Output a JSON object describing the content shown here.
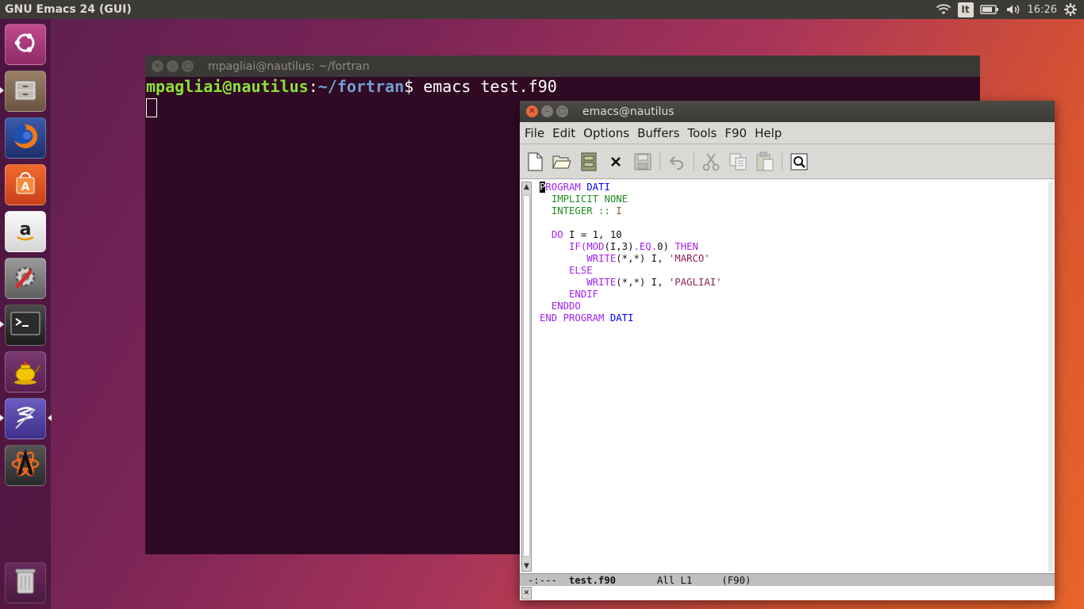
{
  "top_panel": {
    "app_title": "GNU Emacs 24 (GUI)",
    "keyboard_layout": "It",
    "clock": "16:26"
  },
  "launcher": {
    "items": [
      {
        "name": "ubuntu-dash",
        "icon": "ubuntu-logo-icon",
        "color": "#b0397f"
      },
      {
        "name": "files",
        "icon": "file-cabinet-icon",
        "color": "#8a6f52"
      },
      {
        "name": "firefox",
        "icon": "firefox-icon",
        "color": "#e66000"
      },
      {
        "name": "software-center",
        "icon": "shopping-bag-icon",
        "color": "#e95420"
      },
      {
        "name": "amazon",
        "icon": "amazon-icon",
        "color": "#f3f3f3"
      },
      {
        "name": "system-settings",
        "icon": "settings-wrench-icon",
        "color": "#888"
      },
      {
        "name": "terminal",
        "icon": "terminal-icon",
        "color": "#2c2c2c"
      },
      {
        "name": "teapot",
        "icon": "teapot-icon",
        "color": "#f5c400"
      },
      {
        "name": "emacs",
        "icon": "emacs-icon",
        "color": "#5b4aa6"
      },
      {
        "name": "atom",
        "icon": "atom-icon",
        "color": "#c64010"
      },
      {
        "name": "trash",
        "icon": "trash-icon",
        "color": "#777"
      }
    ]
  },
  "terminal": {
    "title": "mpagliai@nautilus: ~/fortran",
    "prompt_user": "mpagliai@nautilus",
    "prompt_sep": ":",
    "prompt_path": "~/fortran",
    "prompt_end": "$ ",
    "command": "emacs test.f90"
  },
  "emacs": {
    "title": "emacs@nautilus",
    "menu": [
      "File",
      "Edit",
      "Options",
      "Buffers",
      "Tools",
      "F90",
      "Help"
    ],
    "toolbar_icons": [
      "new-file-icon",
      "open-folder-icon",
      "dired-icon",
      "close-icon",
      "save-icon",
      "undo-icon",
      "cut-icon",
      "copy-icon",
      "paste-icon",
      "search-icon"
    ],
    "code_lines": [
      "PROGRAM DATI",
      "  IMPLICIT NONE",
      "  INTEGER :: I",
      "",
      "  DO I = 1, 10",
      "     IF(MOD(I,3).EQ.0) THEN",
      "        WRITE(*,*) I, 'MARCO'",
      "     ELSE",
      "        WRITE(*,*) I, 'PAGLIAI'",
      "     ENDIF",
      "  ENDDO",
      "END PROGRAM DATI"
    ],
    "modeline": {
      "status": "-:---",
      "buffer_name": "test.f90",
      "position": "All L1",
      "mode": "(F90)"
    }
  }
}
